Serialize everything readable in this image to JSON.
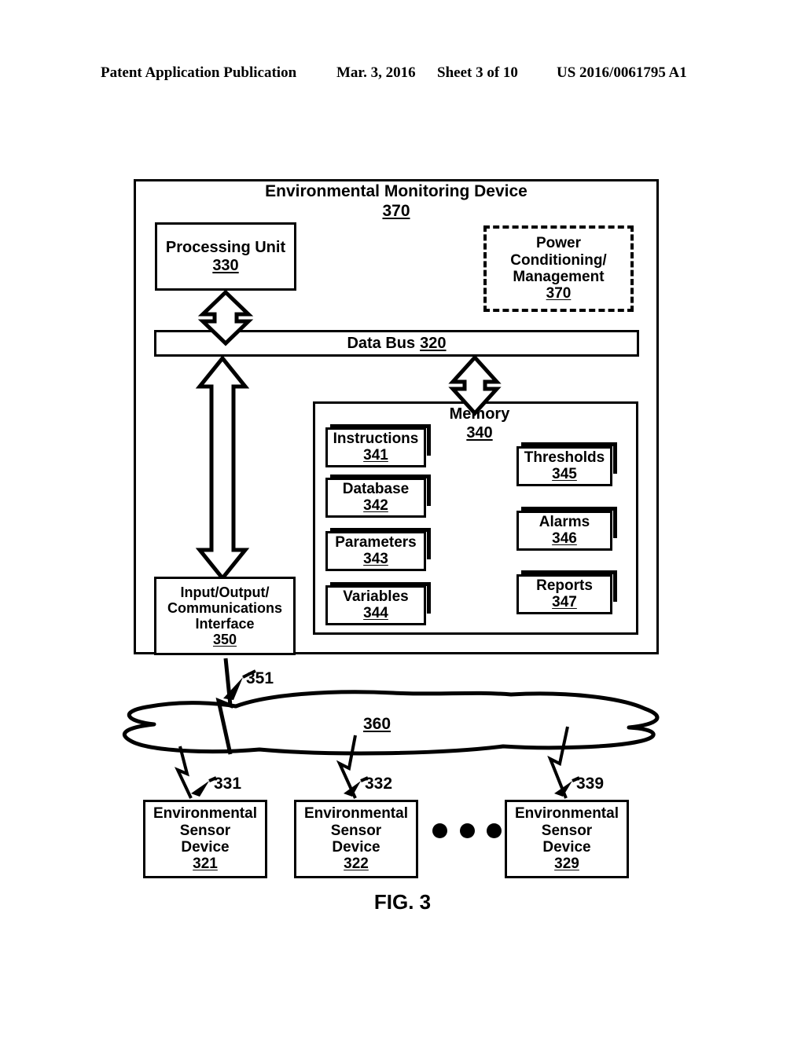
{
  "header": {
    "publication": "Patent Application Publication",
    "date": "Mar. 3, 2016",
    "sheet": "Sheet 3 of 10",
    "patent_number": "US 2016/0061795 A1"
  },
  "figure": {
    "caption": "FIG. 3"
  },
  "device": {
    "title": "Environmental Monitoring Device",
    "ref": "370"
  },
  "processing_unit": {
    "label": "Processing Unit",
    "ref": "330"
  },
  "power_conditioning": {
    "line1": "Power",
    "line2": "Conditioning/",
    "line3": "Management",
    "ref": "370"
  },
  "data_bus": {
    "label": "Data Bus",
    "ref": "320"
  },
  "memory": {
    "label": "Memory",
    "ref": "340",
    "blocks_left": [
      {
        "label": "Instructions",
        "ref": "341"
      },
      {
        "label": "Database",
        "ref": "342"
      },
      {
        "label": "Parameters",
        "ref": "343"
      },
      {
        "label": "Variables",
        "ref": "344"
      }
    ],
    "blocks_right": [
      {
        "label": "Thresholds",
        "ref": "345"
      },
      {
        "label": "Alarms",
        "ref": "346"
      },
      {
        "label": "Reports",
        "ref": "347"
      }
    ]
  },
  "io_interface": {
    "line1": "Input/Output/",
    "line2": "Communications",
    "line3": "Interface",
    "ref": "350"
  },
  "network": {
    "ref": "360",
    "link_uplink_ref": "351",
    "link_refs": [
      "331",
      "332",
      "339"
    ]
  },
  "sensors": [
    {
      "line1": "Environmental",
      "line2": "Sensor",
      "line3": "Device",
      "ref": "321"
    },
    {
      "line1": "Environmental",
      "line2": "Sensor",
      "line3": "Device",
      "ref": "322"
    },
    {
      "line1": "Environmental",
      "line2": "Sensor",
      "line3": "Device",
      "ref": "329"
    }
  ],
  "colors": {
    "ink": "#000000",
    "paper": "#ffffff"
  }
}
